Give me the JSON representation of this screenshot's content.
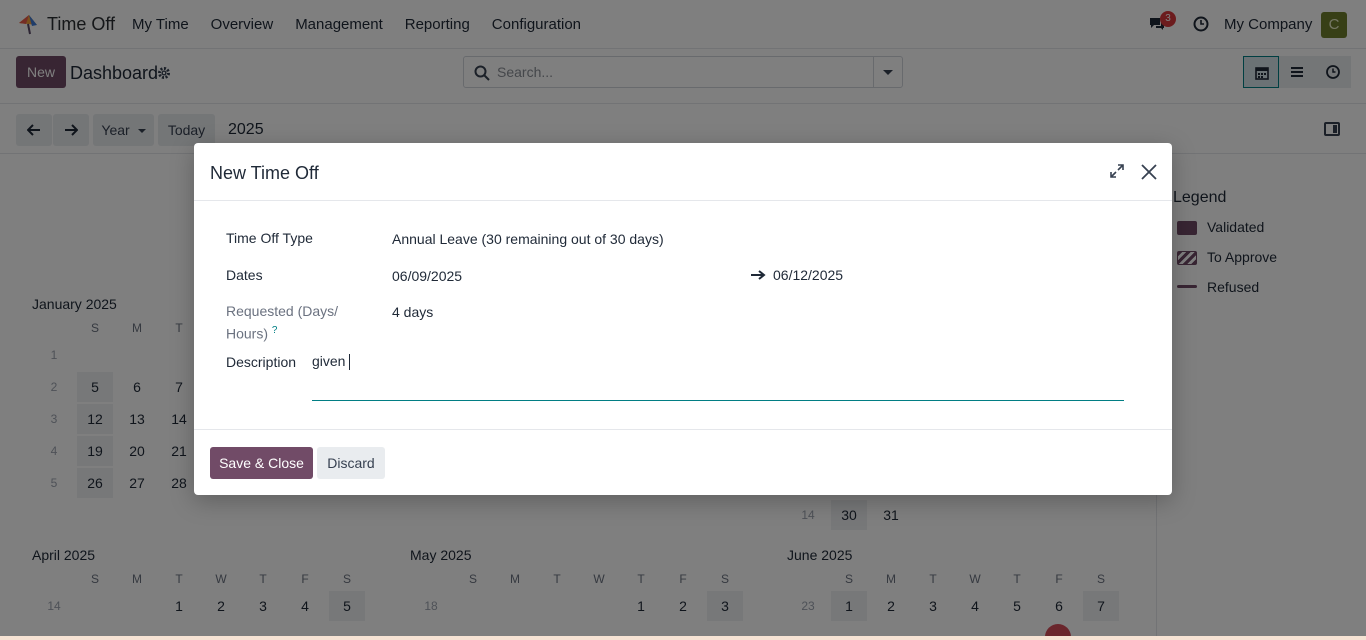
{
  "navbar": {
    "app_name": "Time Off",
    "menu": [
      "My Time",
      "Overview",
      "Management",
      "Reporting",
      "Configuration"
    ],
    "notification_count": "3",
    "company": "My Company",
    "avatar_letter": "C"
  },
  "control_panel": {
    "new_label": "New",
    "breadcrumb": "Dashboard",
    "search_placeholder": "Search..."
  },
  "calendar_toolbar": {
    "scale_label": "Year",
    "today_label": "Today",
    "current_period": "2025"
  },
  "calendar": {
    "day_headers": [
      "S",
      "M",
      "T",
      "W",
      "T",
      "F",
      "S"
    ],
    "january": {
      "title": "January 2025",
      "weeks": [
        "1",
        "2",
        "3",
        "4",
        "5"
      ],
      "rows": [
        [
          "5",
          "6",
          "7"
        ],
        [
          "12",
          "13",
          "14"
        ],
        [
          "19",
          "20",
          "21"
        ],
        [
          "26",
          "27",
          "28"
        ]
      ]
    },
    "march_tail": {
      "week": "14",
      "days": [
        "30",
        "31"
      ]
    },
    "april": {
      "title": "April 2025",
      "week": "14",
      "days": [
        "1",
        "2",
        "3",
        "4",
        "5"
      ]
    },
    "may": {
      "title": "May 2025",
      "week": "18",
      "days": [
        "1",
        "2",
        "3"
      ]
    },
    "june": {
      "title": "June 2025",
      "week": "23",
      "days": [
        "1",
        "2",
        "3",
        "4",
        "5",
        "6",
        "7"
      ]
    }
  },
  "legend": {
    "title": "Legend",
    "items": [
      "Validated",
      "To Approve",
      "Refused"
    ]
  },
  "modal": {
    "title": "New Time Off",
    "fields": {
      "type_label": "Time Off Type",
      "type_value": "Annual Leave (30 remaining out of 30 days)",
      "dates_label": "Dates",
      "date_from": "06/09/2025",
      "date_to": "06/12/2025",
      "requested_label_1": "Requested (Days/",
      "requested_label_2": "Hours)",
      "requested_help": "?",
      "requested_value": "4 days",
      "description_label": "Description",
      "description_value": "given "
    },
    "save_label": "Save & Close",
    "discard_label": "Discard"
  },
  "colors": {
    "brand": "#714b67",
    "accent": "#017e84",
    "badge": "#d9383c"
  }
}
